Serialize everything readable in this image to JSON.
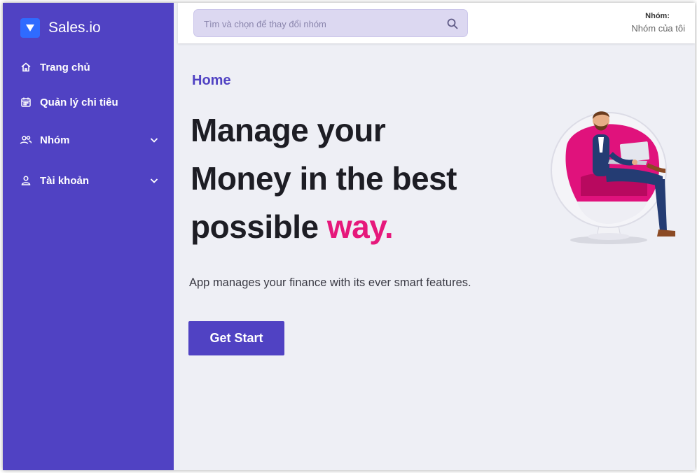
{
  "brand": {
    "name": "Sales.io",
    "logo_icon": "triangle-down-icon",
    "logo_color": "#2f6bff"
  },
  "sidebar": {
    "background": "#5042c3",
    "items": [
      {
        "label": "Trang chủ",
        "icon": "home-icon"
      },
      {
        "label": "Quản lý chi tiêu",
        "icon": "calendar-icon"
      },
      {
        "label": "Nhóm",
        "icon": "users-icon",
        "expandable": true
      },
      {
        "label": "Tài khoản",
        "icon": "user-icon",
        "expandable": true
      }
    ]
  },
  "search": {
    "placeholder": "Tìm và chọn để thay đổi nhóm",
    "icon": "search-icon"
  },
  "group": {
    "label": "Nhóm:",
    "value": "Nhóm của tôi"
  },
  "main": {
    "page_title": "Home",
    "hero": {
      "line1": "Manage your",
      "line2": "Money in the best",
      "line3": "possible ",
      "accent": "way."
    },
    "subtitle": "App manages your finance with its ever smart features.",
    "cta_label": "Get Start"
  },
  "colors": {
    "accent": "#e6187b",
    "primary": "#5042c3"
  }
}
